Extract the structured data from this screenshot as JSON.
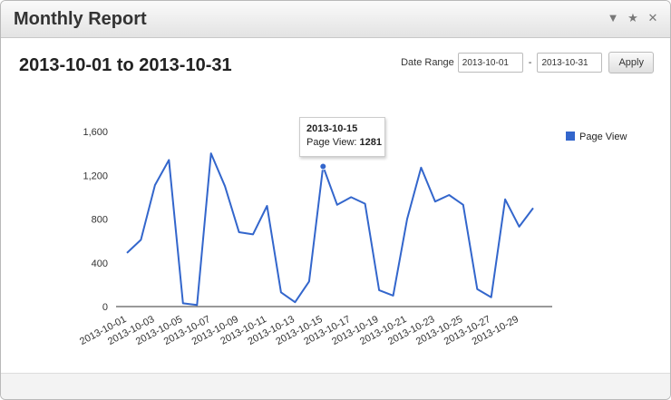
{
  "window": {
    "title": "Monthly Report"
  },
  "icons": {
    "collapse": "chevron-down-icon",
    "favorite": "star-icon",
    "close": "close-icon"
  },
  "report": {
    "range_title": "2013-10-01 to 2013-10-31"
  },
  "date_range": {
    "label": "Date Range",
    "start": "2013-10-01",
    "separator": "-",
    "end": "2013-10-31",
    "apply_label": "Apply"
  },
  "tooltip": {
    "date": "2013-10-15",
    "series_label": "Page View:",
    "value": "1281"
  },
  "colors": {
    "series": "#3366cc"
  },
  "chart_data": {
    "type": "line",
    "x": [
      "2013-10-01",
      "2013-10-02",
      "2013-10-03",
      "2013-10-04",
      "2013-10-05",
      "2013-10-06",
      "2013-10-07",
      "2013-10-08",
      "2013-10-09",
      "2013-10-10",
      "2013-10-11",
      "2013-10-12",
      "2013-10-13",
      "2013-10-14",
      "2013-10-15",
      "2013-10-16",
      "2013-10-17",
      "2013-10-18",
      "2013-10-19",
      "2013-10-20",
      "2013-10-21",
      "2013-10-22",
      "2013-10-23",
      "2013-10-24",
      "2013-10-25",
      "2013-10-26",
      "2013-10-27",
      "2013-10-28",
      "2013-10-29",
      "2013-10-30"
    ],
    "xticks": [
      "2013-10-01",
      "2013-10-03",
      "2013-10-05",
      "2013-10-07",
      "2013-10-09",
      "2013-10-11",
      "2013-10-13",
      "2013-10-15",
      "2013-10-17",
      "2013-10-19",
      "2013-10-21",
      "2013-10-23",
      "2013-10-25",
      "2013-10-27",
      "2013-10-29"
    ],
    "series": [
      {
        "name": "Page View",
        "values": [
          490,
          610,
          1110,
          1340,
          30,
          15,
          1400,
          1100,
          680,
          660,
          920,
          130,
          40,
          230,
          1281,
          930,
          1000,
          940,
          150,
          100,
          800,
          1270,
          960,
          1020,
          930,
          160,
          85,
          980,
          730,
          900
        ]
      }
    ],
    "yticks": [
      "0",
      "400",
      "800",
      "1,200",
      "1,600"
    ],
    "ylim": [
      0,
      1600
    ],
    "grid": false,
    "legend": "right",
    "highlight_index": 14
  }
}
